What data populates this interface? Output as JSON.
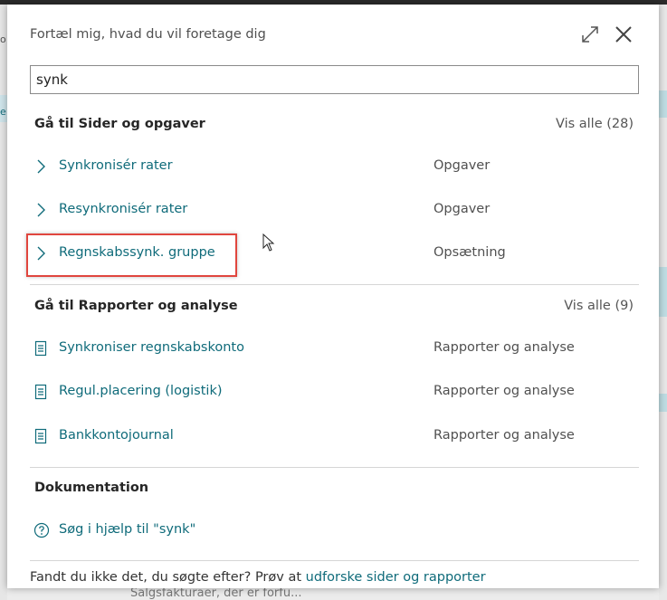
{
  "background": {
    "left_fragment_1": "o",
    "left_fragment_2": "e",
    "bottom_fragment": "Salgsfakturaer, der er forfu..."
  },
  "dialog": {
    "title": "Fortæl mig, hvad du vil foretage dig",
    "icons": {
      "expand": "expand-icon",
      "close": "close-icon"
    }
  },
  "search": {
    "value": "synk"
  },
  "sections": {
    "pages": {
      "title": "Gå til Sider og opgaver",
      "view_all": "Vis alle (28)",
      "items": [
        {
          "label": "Synkronisér rater",
          "category": "Opgaver",
          "icon": "chevron-right-icon"
        },
        {
          "label": "Resynkronisér rater",
          "category": "Opgaver",
          "icon": "chevron-right-icon"
        },
        {
          "label": "Regnskabssynk. gruppe",
          "category": "Opsætning",
          "icon": "chevron-right-icon"
        }
      ]
    },
    "reports": {
      "title": "Gå til Rapporter og analyse",
      "view_all": "Vis alle (9)",
      "items": [
        {
          "label": "Synkroniser regnskabskonto",
          "category": "Rapporter og analyse",
          "icon": "report-icon"
        },
        {
          "label": "Regul.placering (logistik)",
          "category": "Rapporter og analyse",
          "icon": "report-icon"
        },
        {
          "label": "Bankkontojournal",
          "category": "Rapporter og analyse",
          "icon": "report-icon"
        }
      ]
    },
    "documentation": {
      "title": "Dokumentation",
      "help_link": "Søg i hjælp til \"synk\""
    }
  },
  "footer": {
    "text": "Fandt du ikke det, du søgte efter? Prøv at ",
    "link": "udforske sider og rapporter"
  },
  "colors": {
    "link": "#0f6b7a",
    "highlight": "#e0463e"
  }
}
